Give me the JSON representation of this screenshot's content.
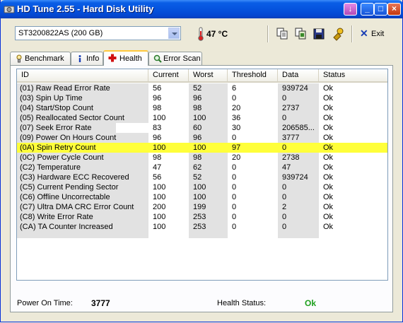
{
  "window": {
    "title": "HD Tune 2.55 - Hard Disk Utility"
  },
  "toolbar": {
    "drive": "ST3200822AS (200 GB)",
    "temperature": "47 °C",
    "exit_label": "Exit"
  },
  "tabs": [
    {
      "label": "Benchmark"
    },
    {
      "label": "Info"
    },
    {
      "label": "Health"
    },
    {
      "label": "Error Scan"
    }
  ],
  "columns": [
    "ID",
    "Current",
    "Worst",
    "Threshold",
    "Data",
    "Status"
  ],
  "rows": [
    [
      "(01) Raw Read Error Rate",
      "56",
      "52",
      "6",
      "939724",
      "Ok"
    ],
    [
      "(03) Spin Up Time",
      "96",
      "96",
      "0",
      "0",
      "Ok"
    ],
    [
      "(04) Start/Stop Count",
      "98",
      "98",
      "20",
      "2737",
      "Ok"
    ],
    [
      "(05) Reallocated Sector Count",
      "100",
      "100",
      "36",
      "0",
      "Ok"
    ],
    [
      "(07) Seek Error Rate",
      "83",
      "60",
      "30",
      "206585...",
      "Ok"
    ],
    [
      "(09) Power On Hours Count",
      "96",
      "96",
      "0",
      "3777",
      "Ok"
    ],
    [
      "(0A) Spin Retry Count",
      "100",
      "100",
      "97",
      "0",
      "Ok"
    ],
    [
      "(0C) Power Cycle Count",
      "98",
      "98",
      "20",
      "2738",
      "Ok"
    ],
    [
      "(C2) Temperature",
      "47",
      "62",
      "0",
      "47",
      "Ok"
    ],
    [
      "(C3) Hardware ECC Recovered",
      "56",
      "52",
      "0",
      "939724",
      "Ok"
    ],
    [
      "(C5) Current Pending Sector",
      "100",
      "100",
      "0",
      "0",
      "Ok"
    ],
    [
      "(C6) Offline Uncorrectable",
      "100",
      "100",
      "0",
      "0",
      "Ok"
    ],
    [
      "(C7) Ultra DMA CRC Error Count",
      "200",
      "199",
      "0",
      "2",
      "Ok"
    ],
    [
      "(C8) Write Error Rate",
      "100",
      "253",
      "0",
      "0",
      "Ok"
    ],
    [
      "(CA) TA Counter Increased",
      "100",
      "253",
      "0",
      "0",
      "Ok"
    ]
  ],
  "selected_row": 6,
  "footer": {
    "power_on_label": "Power On Time:",
    "power_on_value": "3777",
    "health_label": "Health Status:",
    "health_value": "Ok"
  },
  "colors": {
    "selection": "#ffff3a",
    "ok": "#1ea01e",
    "title_bar": "#0553de"
  },
  "icons": [
    "app-disk-icon",
    "thermometer-icon",
    "copy-icon",
    "copy-all-icon",
    "save-icon",
    "options-icon",
    "exit-icon",
    "benchmark-icon",
    "info-icon",
    "health-cross-icon",
    "search-icon"
  ]
}
